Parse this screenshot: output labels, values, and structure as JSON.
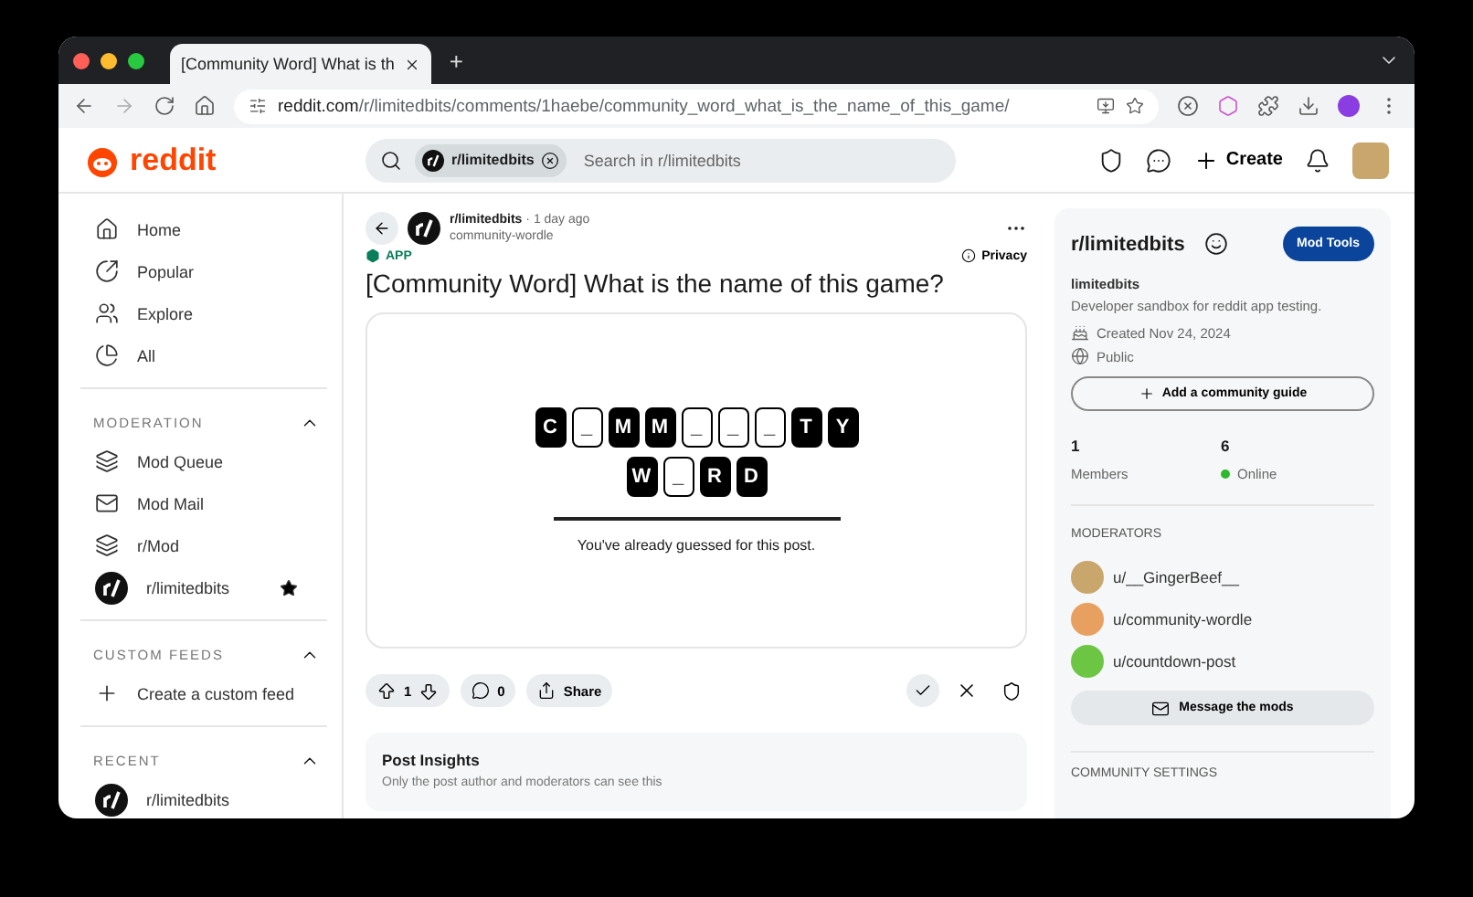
{
  "browser": {
    "tabs": [
      {
        "title": "[Community Word] What is th",
        "selected": true
      }
    ],
    "new_tab": "+",
    "url_host": "reddit.com",
    "url_path": "/r/limitedbits/comments/1haebe/community_word_what_is_the_name_of_this_game/"
  },
  "header": {
    "logo": "reddit",
    "search": {
      "chip": "r/limitedbits",
      "placeholder": "Search in r/limitedbits"
    },
    "create": "Create"
  },
  "sidebar": {
    "nav": [
      {
        "label": "Home"
      },
      {
        "label": "Popular"
      },
      {
        "label": "Explore"
      },
      {
        "label": "All"
      }
    ],
    "sections": [
      {
        "title": "MODERATION",
        "expanded": true,
        "items": [
          {
            "kind": "icon",
            "label": "Mod Queue",
            "starred": false
          },
          {
            "kind": "icon",
            "label": "Mod Mail",
            "starred": false
          },
          {
            "kind": "icon",
            "label": "r/Mod",
            "starred": false
          },
          {
            "kind": "community",
            "label": "r/limitedbits",
            "starred": true
          }
        ]
      },
      {
        "title": "CUSTOM FEEDS",
        "expanded": true,
        "items": [
          {
            "kind": "add",
            "label": "Create a custom feed",
            "starred": false
          }
        ]
      },
      {
        "title": "RECENT",
        "expanded": true,
        "items": [
          {
            "kind": "community",
            "label": "r/limitedbits",
            "starred": false
          }
        ]
      }
    ]
  },
  "post": {
    "subreddit": "r/limitedbits",
    "separator": "·",
    "time": "1 day ago",
    "author": "community-wordle",
    "badge": "APP",
    "privacy": "Privacy",
    "title": "[Community Word] What is the name of this game?",
    "puzzle": {
      "rows": [
        [
          {
            "kind": "letter",
            "char": "C"
          },
          {
            "kind": "blank",
            "char": "_"
          },
          {
            "kind": "letter",
            "char": "M"
          },
          {
            "kind": "letter",
            "char": "M"
          },
          {
            "kind": "blank",
            "char": "_"
          },
          {
            "kind": "blank",
            "char": "_"
          },
          {
            "kind": "blank",
            "char": "_"
          },
          {
            "kind": "letter",
            "char": "T"
          },
          {
            "kind": "letter",
            "char": "Y"
          }
        ],
        [
          {
            "kind": "letter",
            "char": "W"
          },
          {
            "kind": "blank",
            "char": "_"
          },
          {
            "kind": "letter",
            "char": "R"
          },
          {
            "kind": "letter",
            "char": "D"
          }
        ]
      ],
      "message": "You've already guessed for this post."
    },
    "votes": "1",
    "comments": "0",
    "share": "Share",
    "insights": {
      "title": "Post Insights",
      "note": "Only the post author and moderators can see this"
    }
  },
  "community": {
    "name": "r/limitedbits",
    "mod_tools": "Mod Tools",
    "display_name": "limitedbits",
    "description": "Developer sandbox for reddit app testing.",
    "created": "Created Nov 24, 2024",
    "visibility": "Public",
    "guide_button": "Add a community guide",
    "stats": [
      {
        "value": "1",
        "label": "Members"
      },
      {
        "value": "6",
        "label": "Online",
        "color": "#2eb82e"
      }
    ],
    "moderators_title": "MODERATORS",
    "moderators": [
      {
        "name": "u/__GingerBeef__",
        "color": "#c9a66b"
      },
      {
        "name": "u/community-wordle",
        "color": "#e8a060"
      },
      {
        "name": "u/countdown-post",
        "color": "#6cc644"
      }
    ],
    "message_button": "Message the mods",
    "settings_title": "COMMUNITY SETTINGS"
  }
}
